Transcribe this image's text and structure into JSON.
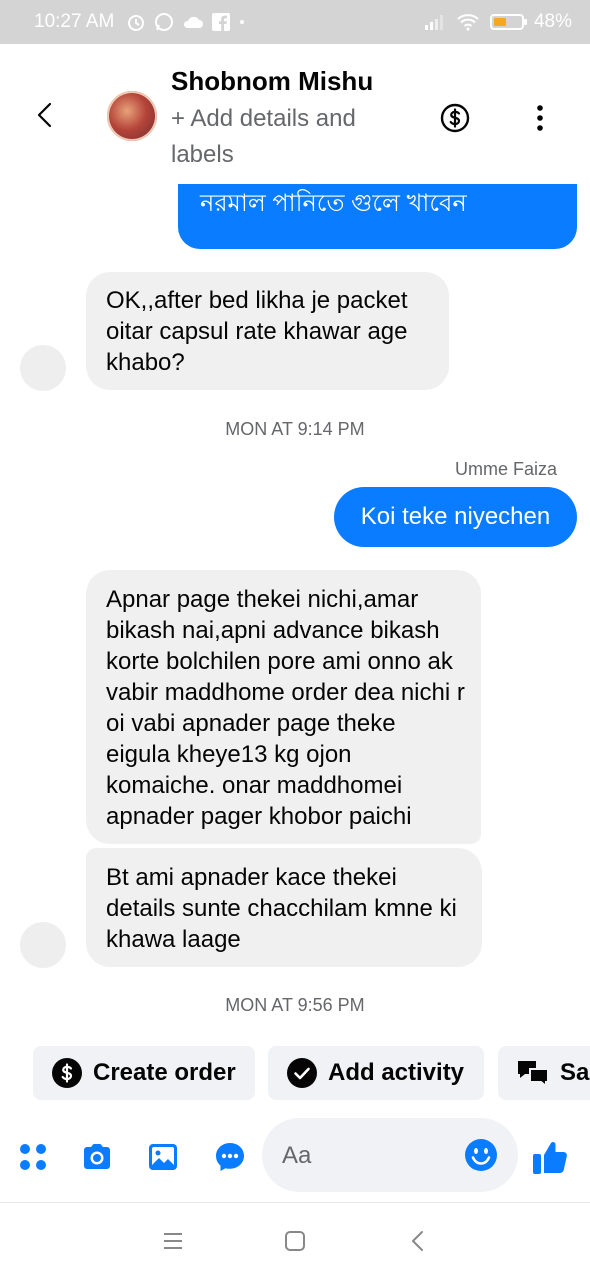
{
  "status_bar": {
    "time": "10:27 AM",
    "battery": "48%",
    "battery_level": 0.48,
    "icons": [
      "alarm-icon",
      "whatsapp-icon",
      "cloud-icon",
      "facebook-icon",
      "dot-icon",
      "signal-icon",
      "wifi-icon",
      "battery-icon"
    ]
  },
  "header": {
    "contact_name": "Shobnom Mishu",
    "add_details": "+ Add details and labels"
  },
  "messages": {
    "partial_out": "নরমাল পানিতে গুলে খাবেন",
    "in_1": "OK,,after bed likha je packet oitar capsul rate khawar age khabo?",
    "timestamp_1": "MON AT 9:14 PM",
    "sender_label": "Umme Faiza",
    "out_1": "Koi teke niyechen",
    "in_2": "Apnar page thekei nichi,amar bikash nai,apni advance bikash korte bolchilen pore ami onno ak vabir maddhome order dea nichi r oi vabi apnader page theke eigula kheye13 kg ojon komaiche. onar maddhomei apnader pager khobor paichi",
    "in_3": "Bt ami apnader kace thekei details sunte chacchilam kmne ki khawa laage",
    "timestamp_2": "MON AT 9:56 PM"
  },
  "actions": {
    "create_order": "Create order",
    "add_activity": "Add activity",
    "saved_replies": "Sa"
  },
  "composer": {
    "placeholder": "Aa"
  },
  "colors": {
    "accent": "#0a7cff",
    "incoming_bubble": "#f0f0f0",
    "secondary_text": "#65676b"
  }
}
